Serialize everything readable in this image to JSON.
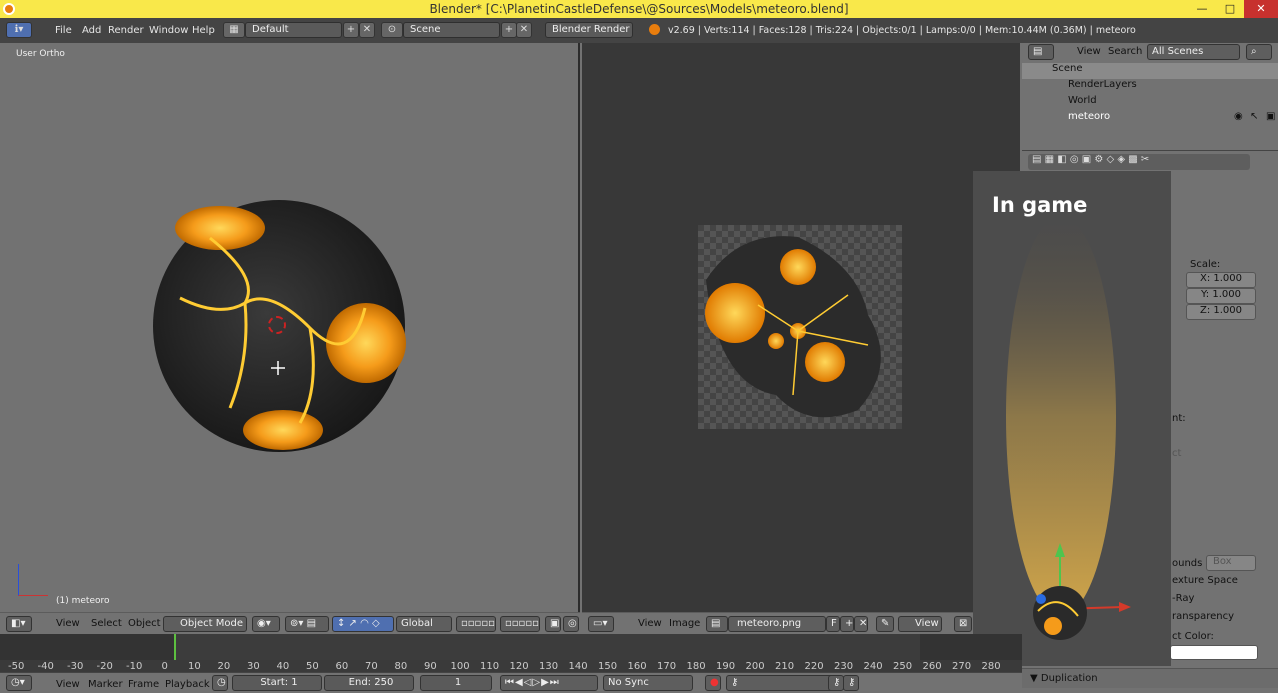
{
  "window": {
    "title": "Blender* [C:\\PlanetinCastleDefense\\@Sources\\Models\\meteoro.blend]",
    "controls": [
      "—",
      "□",
      "✕"
    ]
  },
  "info_header": {
    "menus": [
      "File",
      "Add",
      "Render",
      "Window",
      "Help"
    ],
    "layout": "Default",
    "scene": "Scene",
    "engine": "Blender Render",
    "stats": "v2.69 | Verts:114 | Faces:128 | Tris:224 | Objects:0/1 | Lamps:0/0 | Mem:10.44M (0.36M) | meteoro"
  },
  "viewport3d": {
    "label": "User Ortho",
    "object_label": "(1) meteoro",
    "header": {
      "menus": [
        "View",
        "Select",
        "Object"
      ],
      "mode": "Object Mode",
      "orientation": "Global"
    }
  },
  "image_editor": {
    "header": {
      "menus": [
        "View",
        "Image"
      ],
      "image": "meteoro.png",
      "fake_user": "F",
      "view": "View"
    }
  },
  "outliner": {
    "menus": [
      "View",
      "Search"
    ],
    "filter": "All Scenes",
    "items": [
      "Scene",
      "RenderLayers",
      "World",
      "meteoro"
    ]
  },
  "properties": {
    "scale_label": "Scale:",
    "scale": [
      "X: 1.000",
      "Y: 1.000",
      "Z: 1.000"
    ],
    "partial_labels": [
      "nt:",
      "ct",
      "ounds",
      "exture Space",
      "-Ray",
      "ransparency",
      "ct Color:"
    ],
    "bounds_value": "Box",
    "section": "Duplication"
  },
  "overlay": {
    "title": "In game"
  },
  "timeline": {
    "ticks": [
      "-50",
      "-40",
      "-30",
      "-20",
      "-10",
      "0",
      "10",
      "20",
      "30",
      "40",
      "50",
      "60",
      "70",
      "80",
      "90",
      "100",
      "110",
      "120",
      "130",
      "140",
      "150",
      "160",
      "170",
      "180",
      "190",
      "200",
      "210",
      "220",
      "230",
      "240",
      "250",
      "260",
      "270",
      "280"
    ],
    "menus": [
      "View",
      "Marker",
      "Frame",
      "Playback"
    ],
    "start": "Start: 1",
    "end": "End: 250",
    "current": "1",
    "sync": "No Sync"
  },
  "colors": {
    "titlebar": "#f9e84a",
    "panel": "#727272",
    "header": "#444444",
    "timeline": "#333333",
    "accent": "#f59b1a"
  }
}
